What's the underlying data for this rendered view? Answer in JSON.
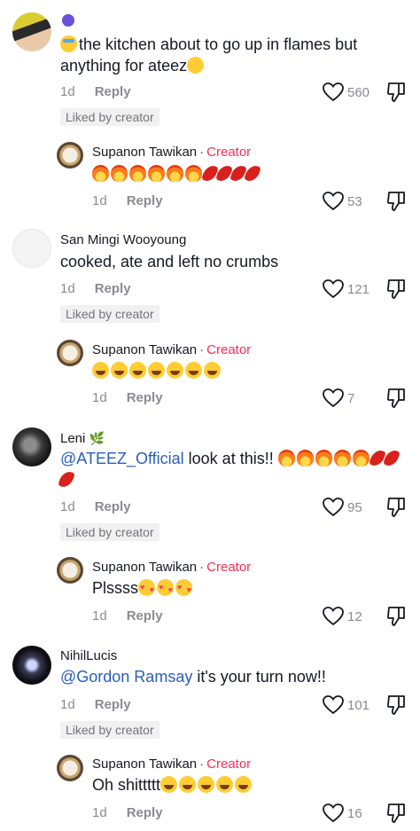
{
  "comments": [
    {
      "prefix_emoji": "grapes-emoji",
      "text": "the kitchen about to go up in flames but anything for ateez",
      "age": "1d",
      "reply_label": "Reply",
      "likes": "560",
      "badge": "Liked by creator",
      "reply": {
        "user": "Supanon Tawikan",
        "sep": "·",
        "creator_label": "Creator",
        "age": "1d",
        "reply_label": "Reply",
        "likes": "53"
      }
    },
    {
      "user": "San Mingi Wooyoung",
      "text": "cooked, ate and left no crumbs",
      "age": "1d",
      "reply_label": "Reply",
      "likes": "121",
      "badge": "Liked by creator",
      "reply": {
        "user": "Supanon Tawikan",
        "sep": "·",
        "creator_label": "Creator",
        "age": "1d",
        "reply_label": "Reply",
        "likes": "7"
      }
    },
    {
      "user": "Leni",
      "mention": "@ATEEZ_Official",
      "text": "look at this!!",
      "age": "1d",
      "reply_label": "Reply",
      "likes": "95",
      "badge": "Liked by creator",
      "reply": {
        "user": "Supanon Tawikan",
        "sep": "·",
        "creator_label": "Creator",
        "text": "Plssss",
        "age": "1d",
        "reply_label": "Reply",
        "likes": "12"
      }
    },
    {
      "user": "NihilLucis",
      "mention": "@Gordon Ramsay",
      "text": "it's your turn now!!",
      "age": "1d",
      "reply_label": "Reply",
      "likes": "101",
      "badge": "Liked by creator",
      "reply": {
        "user": "Supanon Tawikan",
        "sep": "·",
        "creator_label": "Creator",
        "text": "Oh shittttt",
        "age": "1d",
        "reply_label": "Reply",
        "likes": "16"
      }
    }
  ],
  "colors": {
    "creator": "#fe2c55",
    "mention": "#2b5db9",
    "muted": "#8a8b91"
  }
}
